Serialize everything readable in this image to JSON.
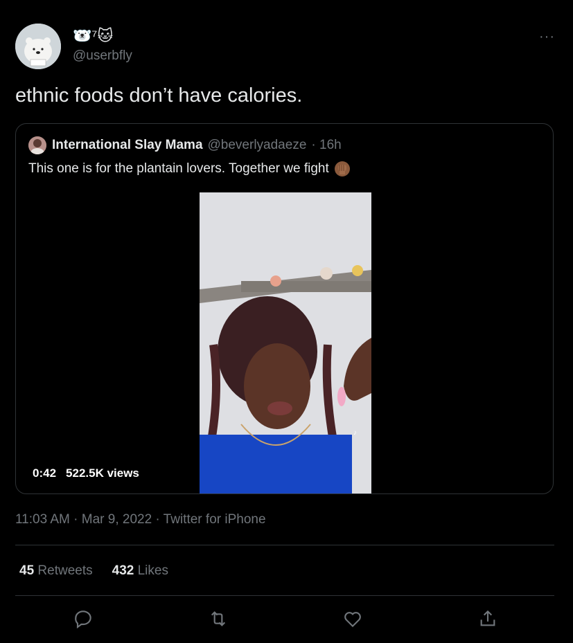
{
  "author": {
    "display_name": "🐻‍❄️⁷🐱",
    "handle": "@userbfly"
  },
  "tweet": {
    "text": "ethnic foods don’t have calories.",
    "timestamp": "11:03 AM · Mar 9, 2022 · Twitter for iPhone"
  },
  "quoted": {
    "name": "International Slay Mama",
    "handle": "@beverlyadaeze",
    "age": "· 16h",
    "text": "This one is for the plantain lovers. Together we fight",
    "emoji": "raised-fist-icon",
    "video": {
      "duration": "0:42",
      "views": "522.5K views"
    }
  },
  "stats": {
    "retweets_count": "45",
    "retweets_label": "Retweets",
    "likes_count": "432",
    "likes_label": "Likes"
  },
  "actions": [
    "reply-icon",
    "retweet-icon",
    "like-icon",
    "share-icon"
  ],
  "colors": {
    "background": "#000000",
    "text": "#e7e9ea",
    "muted": "#71767b",
    "border": "#2f3336"
  }
}
